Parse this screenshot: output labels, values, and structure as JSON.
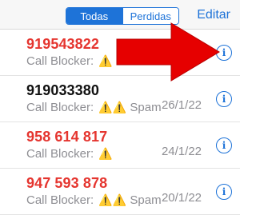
{
  "header": {
    "tabs": [
      "Todas",
      "Perdidas"
    ],
    "active_tab": "Todas",
    "edit_label": "Editar"
  },
  "calls": [
    {
      "number": "919543822",
      "label": "Call Blocker:",
      "warnings": "⚠️",
      "spam": "",
      "date": "",
      "missed": true
    },
    {
      "number": "919033380",
      "label": "Call Blocker:",
      "warnings": "⚠️⚠️",
      "spam": "Spam",
      "date": "26/1/22",
      "missed": false
    },
    {
      "number": "958 614 817",
      "label": "Call Blocker:",
      "warnings": "⚠️",
      "spam": "",
      "date": "24/1/22",
      "missed": true
    },
    {
      "number": "947 593 878",
      "label": "Call Blocker:",
      "warnings": "⚠️⚠️",
      "spam": "Spam",
      "date": "20/1/22",
      "missed": true
    }
  ],
  "icons": {
    "info": "info-icon",
    "annotation": "red-arrow-annotation"
  },
  "colors": {
    "accent": "#1e73d8",
    "missed": "#e5352f",
    "secondary": "#8e8e93",
    "arrow": "#e60000"
  }
}
